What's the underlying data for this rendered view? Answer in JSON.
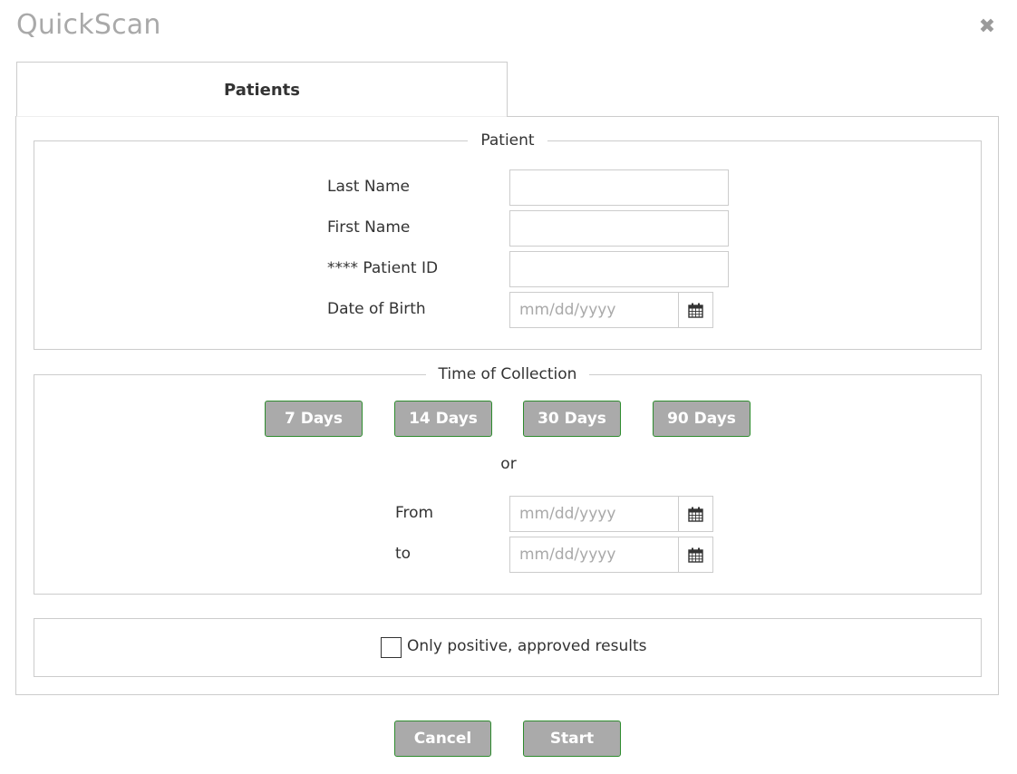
{
  "dialog": {
    "title": "QuickScan",
    "close_icon": "close-icon"
  },
  "tabs": [
    {
      "label": "Patients",
      "active": true
    }
  ],
  "patient_section": {
    "legend": "Patient",
    "fields": {
      "last_name": {
        "label": "Last Name",
        "value": "",
        "placeholder": ""
      },
      "first_name": {
        "label": "First Name",
        "value": "",
        "placeholder": ""
      },
      "patient_id": {
        "label": "**** Patient ID",
        "value": "",
        "placeholder": ""
      },
      "dob": {
        "label": "Date of Birth",
        "value": "",
        "placeholder": "mm/dd/yyyy",
        "icon": "calendar-icon"
      }
    }
  },
  "collection_section": {
    "legend": "Time of Collection",
    "quick_ranges": [
      "7 Days",
      "14 Days",
      "30 Days",
      "90 Days"
    ],
    "or_text": "or",
    "from": {
      "label": "From",
      "value": "",
      "placeholder": "mm/dd/yyyy",
      "icon": "calendar-icon"
    },
    "to": {
      "label": "to",
      "value": "",
      "placeholder": "mm/dd/yyyy",
      "icon": "calendar-icon"
    }
  },
  "filter": {
    "only_positive_label": "Only positive, approved results",
    "checked": false
  },
  "footer": {
    "cancel_label": "Cancel",
    "start_label": "Start"
  },
  "colors": {
    "button_bg": "#aaaaaa",
    "button_border": "#2e8b2e",
    "title": "#a9a9a9",
    "border": "#cccccc"
  }
}
